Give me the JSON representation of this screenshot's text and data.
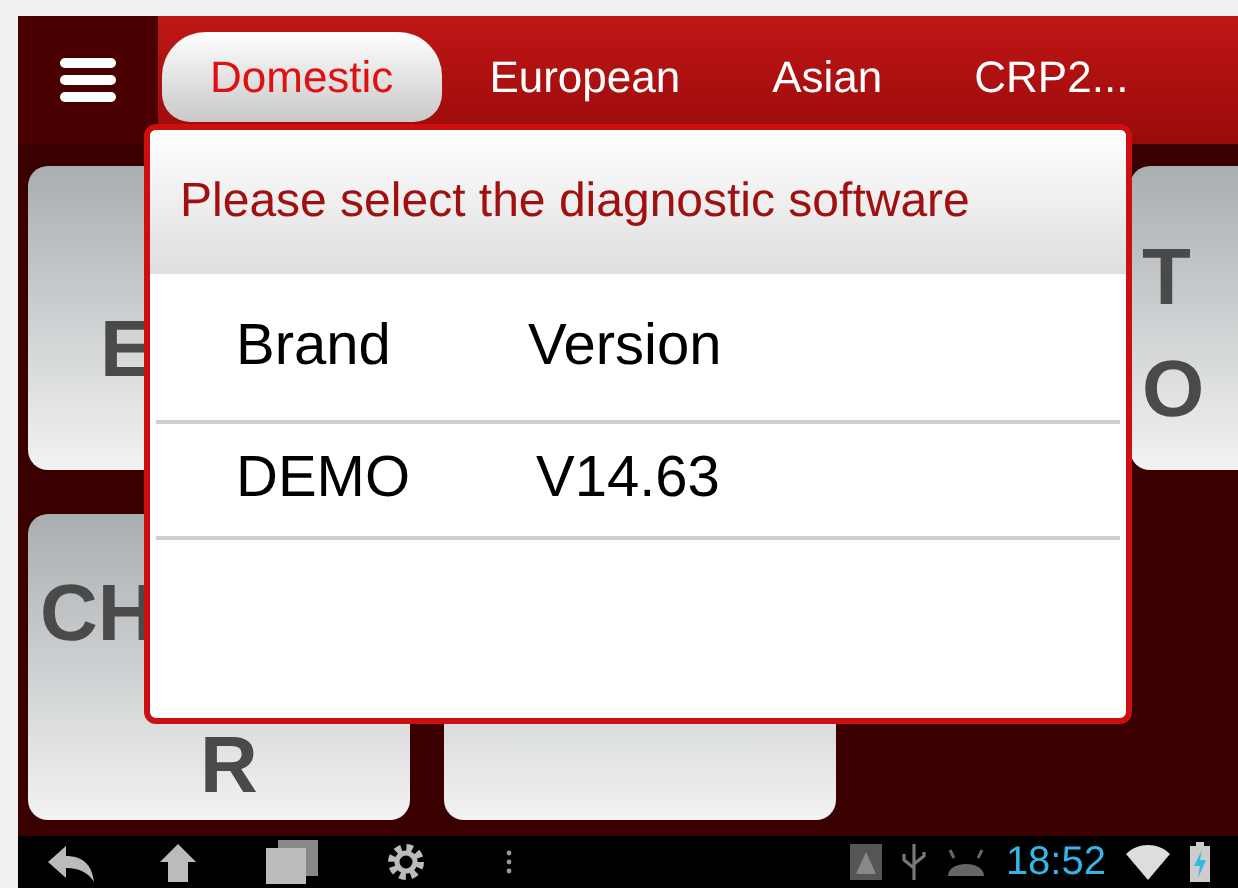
{
  "header": {
    "tabs": [
      {
        "label": "Domestic",
        "selected": true
      },
      {
        "label": "European",
        "selected": false
      },
      {
        "label": "Asian",
        "selected": false
      },
      {
        "label": "CRP2...",
        "selected": false
      }
    ]
  },
  "tiles": [
    {
      "lines": [
        "E"
      ]
    },
    {
      "lines": [
        "T",
        "O"
      ]
    },
    {
      "lines": [
        "CH",
        "R"
      ]
    }
  ],
  "dialog": {
    "title": "Please select the diagnostic software",
    "columns": [
      "Brand",
      "Version"
    ],
    "rows": [
      {
        "brand": "DEMO",
        "version": "V14.63"
      }
    ]
  },
  "status_bar": {
    "time": "18:52"
  }
}
